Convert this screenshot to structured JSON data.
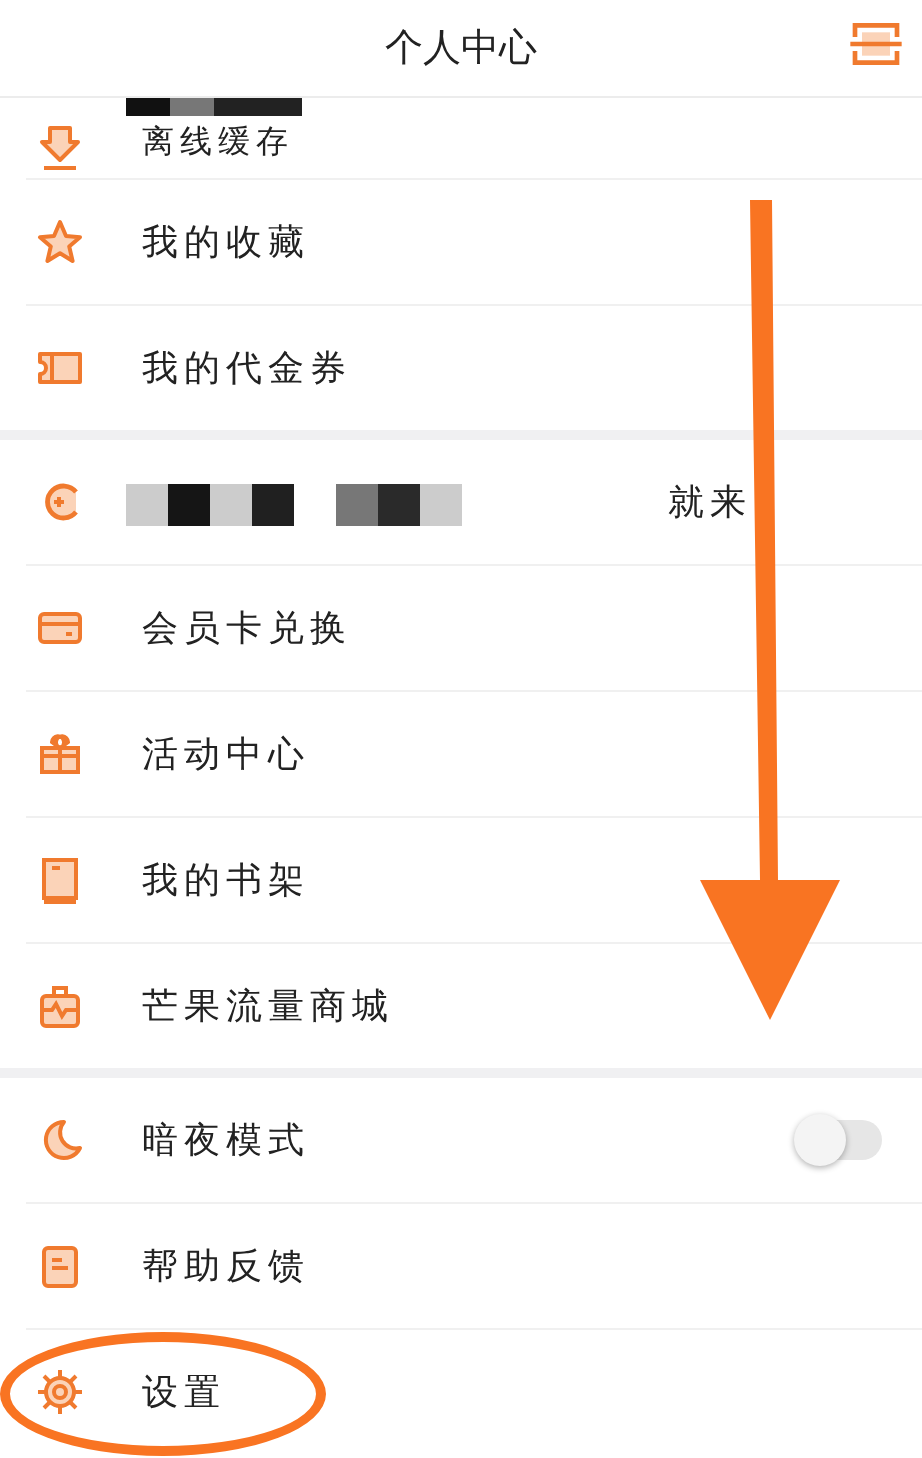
{
  "header": {
    "title": "个人中心"
  },
  "groups": [
    {
      "items": [
        {
          "label": "离线缓存",
          "kind": "link",
          "redacted": true
        },
        {
          "label": "我的收藏",
          "kind": "link"
        },
        {
          "label": "我的代金券",
          "kind": "link"
        }
      ]
    },
    {
      "items": [
        {
          "label": "就来",
          "kind": "link",
          "redacted": true
        },
        {
          "label": "会员卡兑换",
          "kind": "link"
        },
        {
          "label": "活动中心",
          "kind": "link"
        },
        {
          "label": "我的书架",
          "kind": "link"
        },
        {
          "label": "芒果流量商城",
          "kind": "link"
        }
      ]
    },
    {
      "items": [
        {
          "label": "暗夜模式",
          "kind": "toggle",
          "on": false
        },
        {
          "label": "帮助反馈",
          "kind": "link"
        },
        {
          "label": "设置",
          "kind": "link",
          "circled": true
        }
      ]
    }
  ],
  "annotation": {
    "kind": "arrow"
  }
}
